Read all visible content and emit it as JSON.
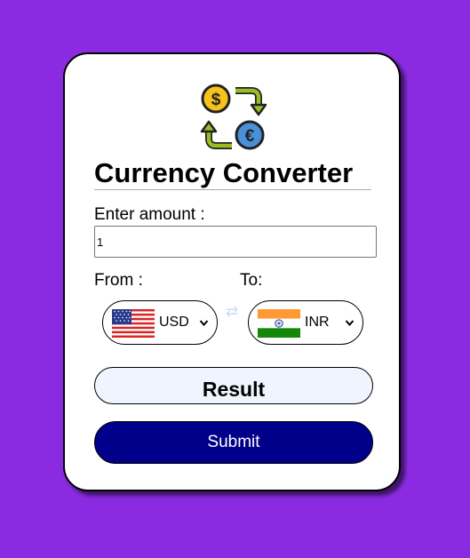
{
  "app": {
    "title": "Currency Converter",
    "logo_icon": "currency-exchange-icon"
  },
  "form": {
    "amount_label": "Enter amount :",
    "amount_value": "1",
    "from_label": "From :",
    "to_label": "To:",
    "from_currency": {
      "code": "USD",
      "flag_icon": "us-flag-icon"
    },
    "to_currency": {
      "code": "INR",
      "flag_icon": "india-flag-icon"
    },
    "swap_glyph": "⇄",
    "result_text": "Result",
    "submit_label": "Submit"
  },
  "colors": {
    "page_background": "#8a2be2",
    "card_background": "#ffffff",
    "submit_background": "#00008b",
    "result_background": "#eef5fe"
  }
}
